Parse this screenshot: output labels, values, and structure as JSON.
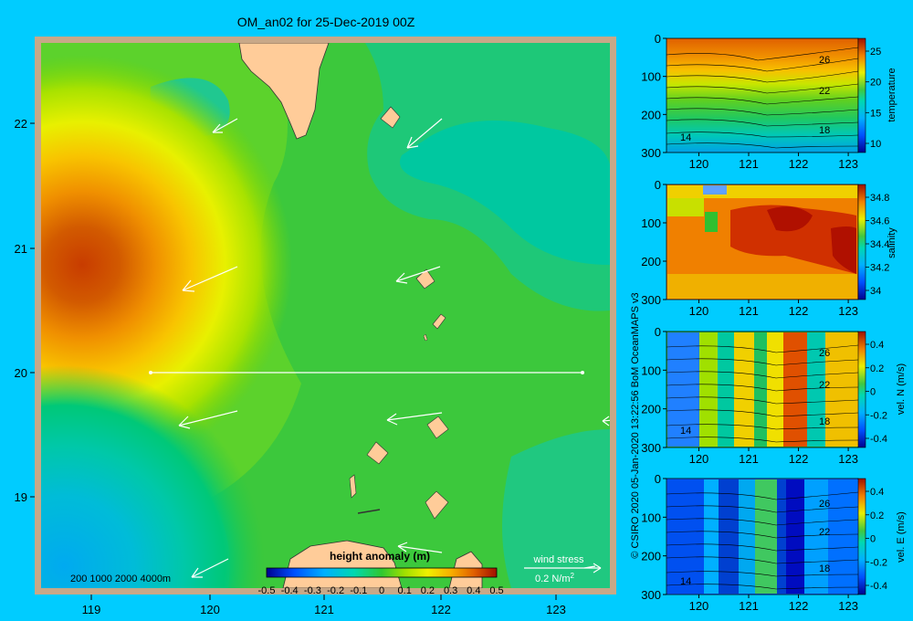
{
  "figure": {
    "title": "OM_an02 for 25-Dec-2019 00Z",
    "credit": "© CSIRO 2020  05-Jan-2020 13:22:56 BoM OceanMAPS v3",
    "colors": {
      "background": "#00ccff",
      "land": "#ffcc99",
      "land_edge": "#c8a888"
    }
  },
  "main_map": {
    "lon_ticks": [
      "119",
      "120",
      "121",
      "122",
      "123"
    ],
    "lat_ticks": [
      "22",
      "21",
      "20",
      "19"
    ],
    "colorbar_title": "height anomaly  (m)",
    "colorbar_ticks": [
      "-0.5",
      "-0.4",
      "-0.3",
      "-0.2",
      "-0.1",
      "0",
      "0.1",
      "0.2",
      "0.3",
      "0.4",
      "0.5"
    ],
    "depth_legend": "200  1000  2000  4000m",
    "wind_legend_label": "wind stress",
    "wind_legend_value": "0.2 N/m",
    "wind_legend_exp": "2"
  },
  "chart_data": [
    {
      "type": "heatmap",
      "title": "OM_an02 for 25-Dec-2019 00Z",
      "variable": "height anomaly (m)",
      "x_ticks": [
        119,
        120,
        121,
        122,
        123
      ],
      "y_ticks": [
        19,
        20,
        21,
        22
      ],
      "xlim": [
        118.5,
        123.5
      ],
      "ylim": [
        18.3,
        22.7
      ],
      "clim": [
        -0.5,
        0.5
      ],
      "features": [
        {
          "kind": "high",
          "lon": 118.9,
          "lat": 20.8,
          "value": 0.45
        },
        {
          "kind": "low",
          "lon": 118.9,
          "lat": 18.6,
          "value": -0.2
        }
      ],
      "section_line": {
        "lon": [
          119.5,
          123.2
        ],
        "lat": [
          20.0,
          20.0
        ]
      }
    },
    {
      "type": "heatmap",
      "label": "temperature",
      "x_ticks": [
        120,
        121,
        122,
        123
      ],
      "y_ticks": [
        0,
        100,
        200,
        300
      ],
      "colorbar_ticks": [
        25,
        20,
        15,
        10
      ],
      "contour_labels": [
        "26",
        "22",
        "18",
        "14"
      ]
    },
    {
      "type": "heatmap",
      "label": "salinity",
      "x_ticks": [
        120,
        121,
        122,
        123
      ],
      "y_ticks": [
        0,
        100,
        200,
        300
      ],
      "colorbar_ticks": [
        34.8,
        34.6,
        34.4,
        34.2,
        34
      ]
    },
    {
      "type": "heatmap",
      "label": "vel. N  (m/s)",
      "x_ticks": [
        120,
        121,
        122,
        123
      ],
      "y_ticks": [
        0,
        100,
        200,
        300
      ],
      "colorbar_ticks": [
        0.4,
        0.2,
        0,
        -0.2,
        -0.4
      ],
      "contour_labels": [
        "26",
        "22",
        "18",
        "14"
      ]
    },
    {
      "type": "heatmap",
      "label": "vel. E  (m/s)",
      "x_ticks": [
        120,
        121,
        122,
        123
      ],
      "y_ticks": [
        0,
        100,
        200,
        300
      ],
      "colorbar_ticks": [
        0.4,
        0.2,
        0,
        -0.2,
        -0.4
      ],
      "contour_labels": [
        "26",
        "22",
        "18",
        "14"
      ]
    }
  ]
}
